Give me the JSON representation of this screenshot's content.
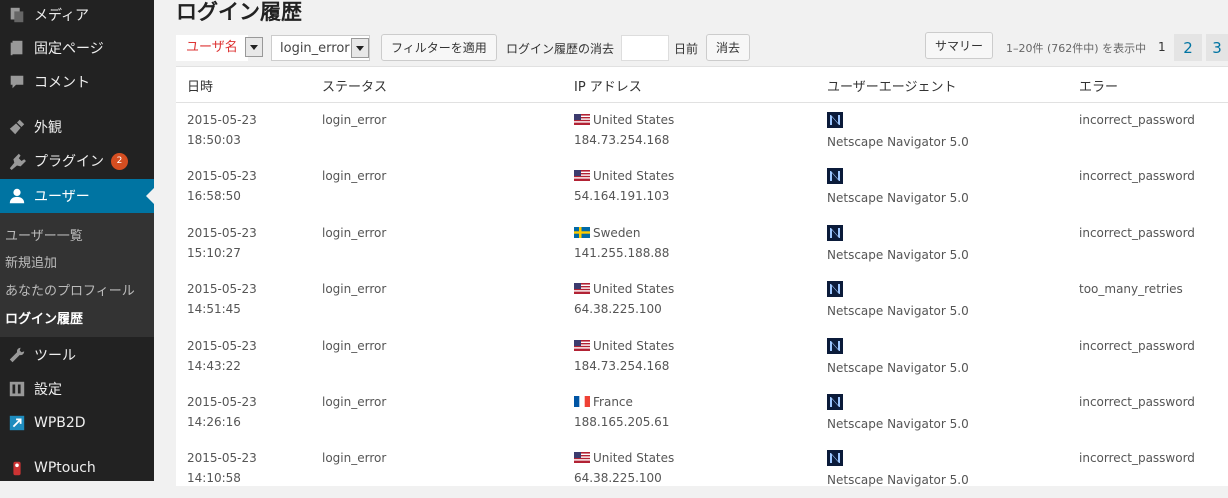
{
  "sidebar": {
    "items": [
      {
        "label": "メディア",
        "icon": "media-icon"
      },
      {
        "label": "固定ページ",
        "icon": "page-icon"
      },
      {
        "label": "コメント",
        "icon": "comment-icon"
      },
      {
        "label": "外観",
        "icon": "appearance-icon"
      },
      {
        "label": "プラグイン",
        "icon": "plugin-icon",
        "badge": "2"
      },
      {
        "label": "ユーザー",
        "icon": "user-icon",
        "active": true
      },
      {
        "label": "ツール",
        "icon": "tools-icon"
      },
      {
        "label": "設定",
        "icon": "settings-icon"
      },
      {
        "label": "WPB2D",
        "icon": "wpb2d-icon"
      },
      {
        "label": "WPtouch",
        "icon": "wptouch-icon"
      }
    ],
    "submenu": [
      "ユーザー一覧",
      "新規追加",
      "あなたのプロフィール",
      "ログイン履歴"
    ]
  },
  "page": {
    "title": "ログイン履歴"
  },
  "toolbar": {
    "filter_field": "ユーザ名",
    "filter_status": "login_error",
    "apply_button": "フィルターを適用",
    "purge_label": "ログイン履歴の消去",
    "days_suffix": "日前",
    "purge_button": "消去",
    "summary_button": "サマリー",
    "displaying": "1–20件 (762件中) を表示中",
    "current_page": "1",
    "page_links": [
      "2",
      "3"
    ]
  },
  "table": {
    "headers": [
      "日時",
      "ステータス",
      "IP アドレス",
      "ユーザーエージェント",
      "エラー"
    ],
    "rows": [
      {
        "date": "2015-05-23",
        "time": "18:50:03",
        "status": "login_error",
        "country": "United States",
        "flag": "us",
        "ip": "184.73.254.168",
        "agent": "Netscape Navigator 5.0",
        "error": "incorrect_password"
      },
      {
        "date": "2015-05-23",
        "time": "16:58:50",
        "status": "login_error",
        "country": "United States",
        "flag": "us",
        "ip": "54.164.191.103",
        "agent": "Netscape Navigator 5.0",
        "error": "incorrect_password"
      },
      {
        "date": "2015-05-23",
        "time": "15:10:27",
        "status": "login_error",
        "country": "Sweden",
        "flag": "se",
        "ip": "141.255.188.88",
        "agent": "Netscape Navigator 5.0",
        "error": "incorrect_password"
      },
      {
        "date": "2015-05-23",
        "time": "14:51:45",
        "status": "login_error",
        "country": "United States",
        "flag": "us",
        "ip": "64.38.225.100",
        "agent": "Netscape Navigator 5.0",
        "error": "too_many_retries"
      },
      {
        "date": "2015-05-23",
        "time": "14:43:22",
        "status": "login_error",
        "country": "United States",
        "flag": "us",
        "ip": "184.73.254.168",
        "agent": "Netscape Navigator 5.0",
        "error": "incorrect_password"
      },
      {
        "date": "2015-05-23",
        "time": "14:26:16",
        "status": "login_error",
        "country": "France",
        "flag": "fr",
        "ip": "188.165.205.61",
        "agent": "Netscape Navigator 5.0",
        "error": "incorrect_password"
      },
      {
        "date": "2015-05-23",
        "time": "14:10:58",
        "status": "login_error",
        "country": "United States",
        "flag": "us",
        "ip": "64.38.225.100",
        "agent": "Netscape Navigator 5.0",
        "error": "incorrect_password"
      }
    ]
  },
  "colors": {
    "sidebar_bg": "#222222",
    "active_bg": "#0074a2",
    "badge": "#d54e21",
    "field_text": "#dd3333",
    "link": "#0074a2"
  }
}
